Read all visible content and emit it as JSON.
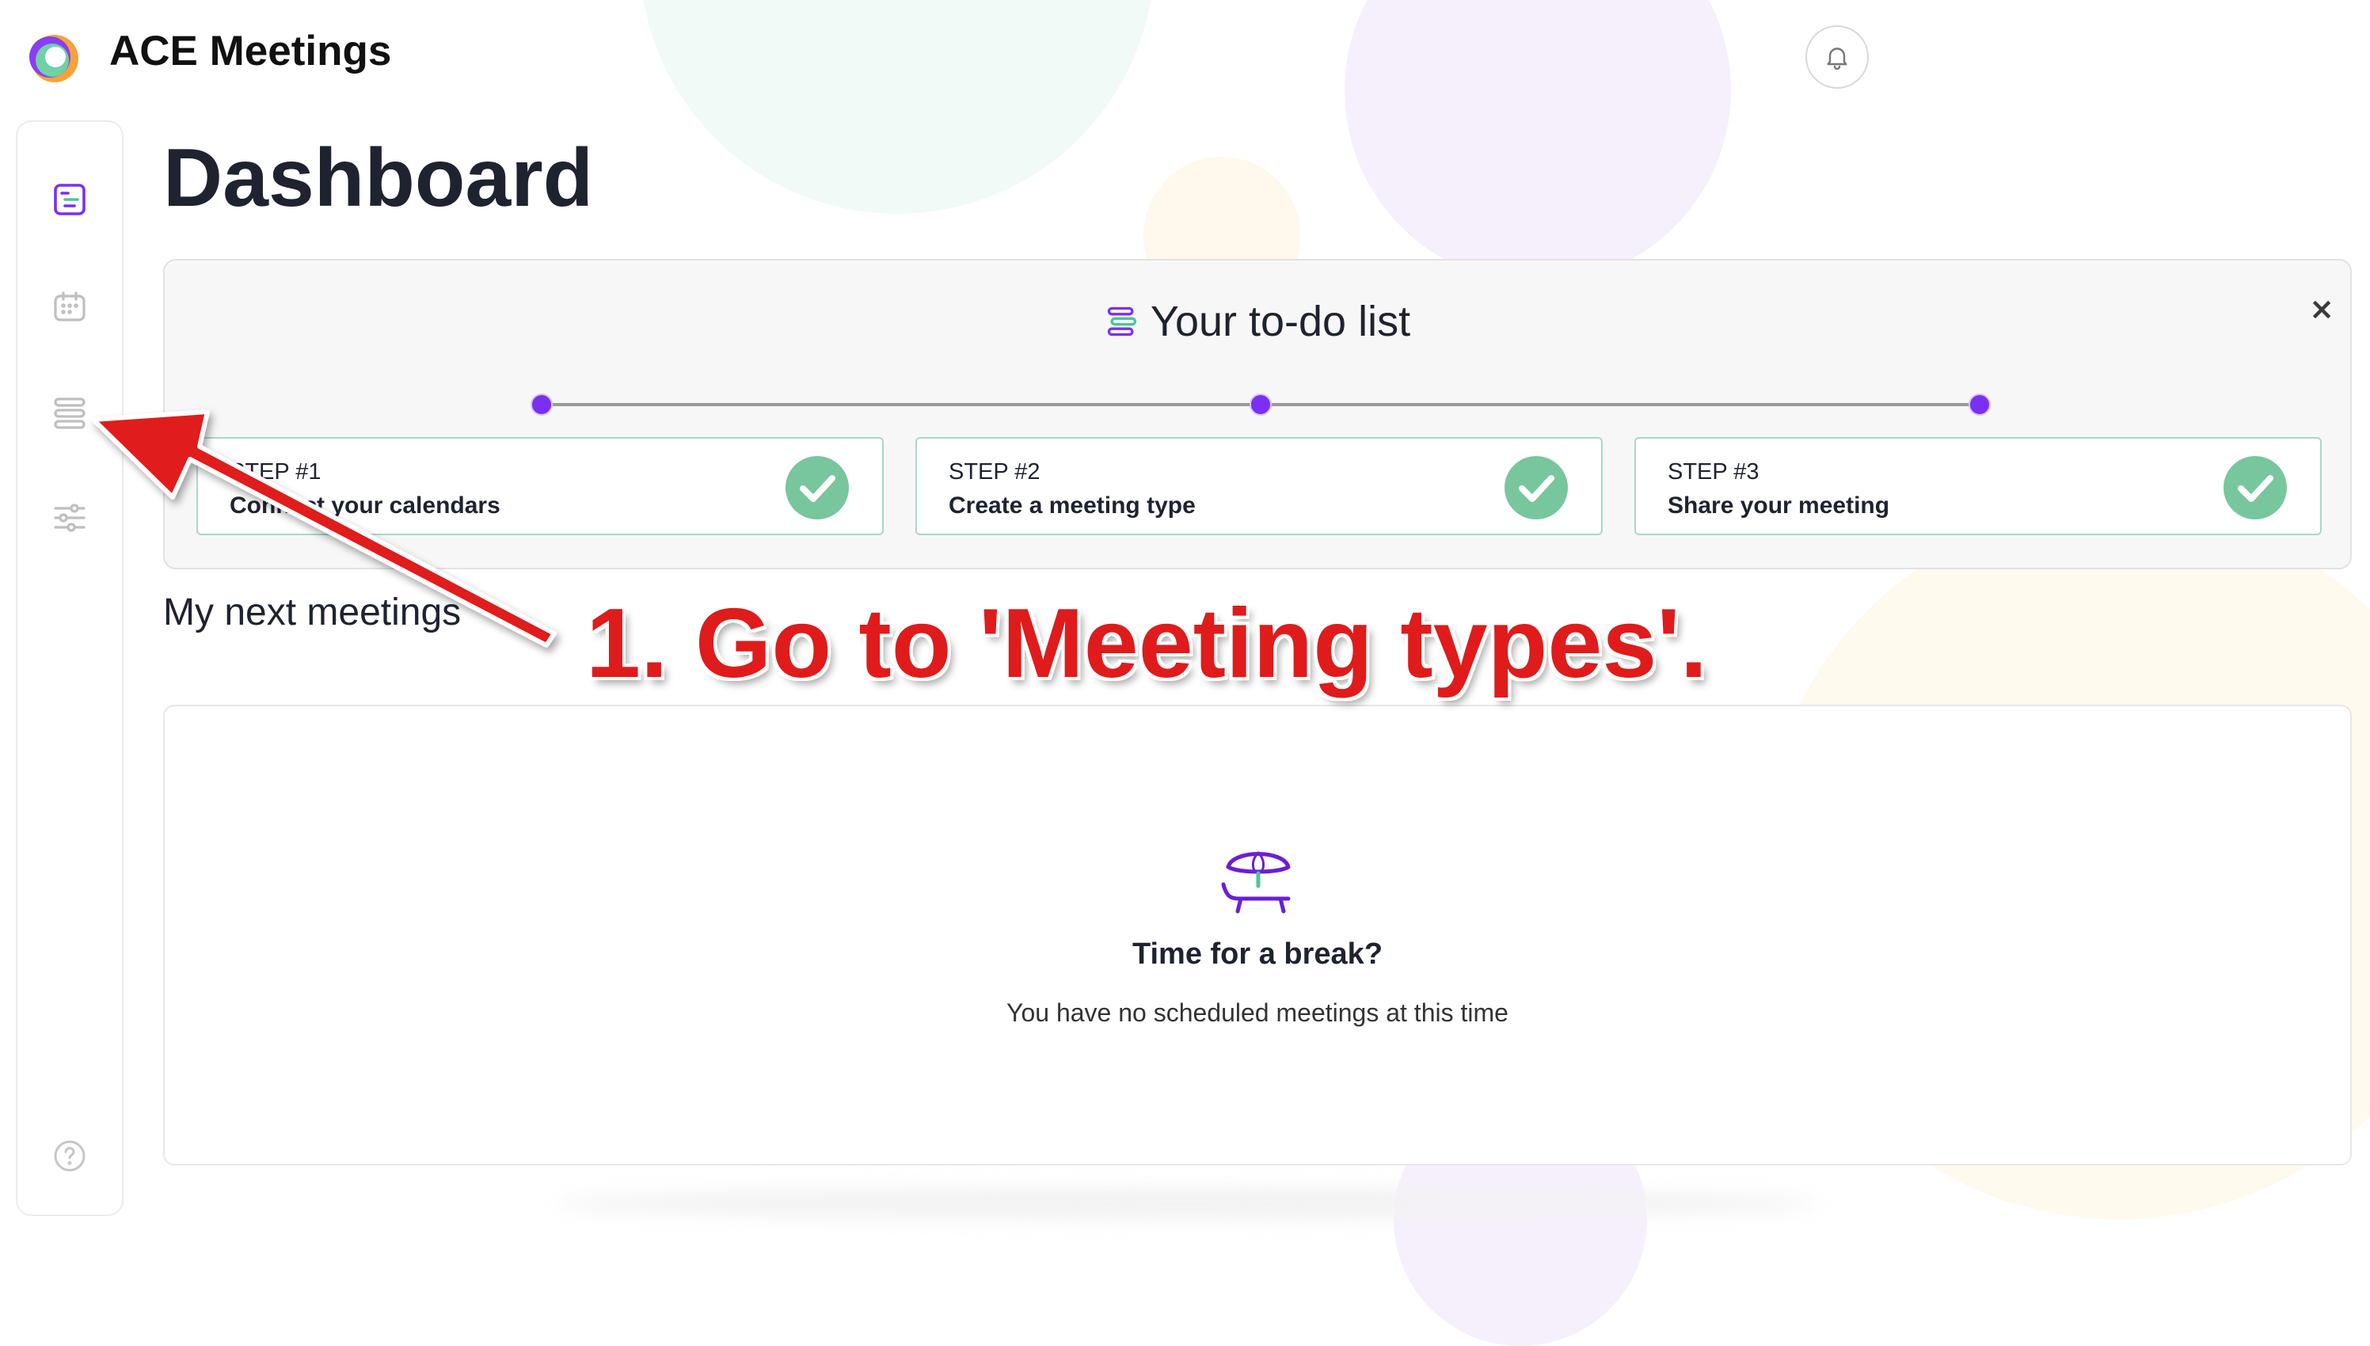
{
  "app": {
    "name": "ACE Meetings"
  },
  "header": {
    "notifications_icon": "bell-icon"
  },
  "sidebar": {
    "items": [
      {
        "name": "dashboard",
        "icon": "dashboard-icon",
        "active": true
      },
      {
        "name": "calendar",
        "icon": "calendar-icon",
        "active": false
      },
      {
        "name": "meeting-types",
        "icon": "meeting-types-icon",
        "active": false
      },
      {
        "name": "settings",
        "icon": "sliders-icon",
        "active": false
      }
    ],
    "help_icon": "help-icon"
  },
  "page": {
    "title": "Dashboard"
  },
  "todo": {
    "title": "Your to-do list",
    "close_label": "×",
    "steps": [
      {
        "number": "STEP #1",
        "label": "Connect your calendars",
        "done": true
      },
      {
        "number": "STEP #2",
        "label": "Create a meeting type",
        "done": true
      },
      {
        "number": "STEP #3",
        "label": "Share your meeting",
        "done": true
      }
    ]
  },
  "next_meetings": {
    "title": "My next meetings",
    "empty_title": "Time for a break?",
    "empty_subtitle": "You have no scheduled meetings at this time"
  },
  "annotation": {
    "text": "1. Go to 'Meeting types'."
  },
  "colors": {
    "accent": "#7b2ff2",
    "success": "#78c69d",
    "annotation": "#e01b1b"
  }
}
